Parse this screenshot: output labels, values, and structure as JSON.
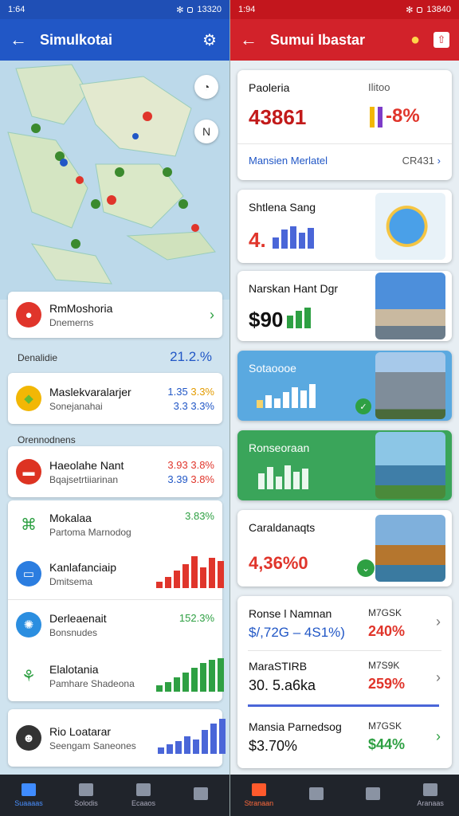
{
  "left": {
    "status": {
      "time": "1:64",
      "right": "13320"
    },
    "title": "Simulkotai",
    "map": {
      "compass_label": "N"
    },
    "featured": {
      "title": "RmMoshoria",
      "subtitle": "Dnemerns"
    },
    "summary": {
      "label": "Denalidie",
      "value": "21.2.%"
    },
    "group1": [
      {
        "title": "Maslekvaralarjer",
        "subtitle": "Sonejanahai",
        "v1": "1.35",
        "v2": "3.3%",
        "v3": "3.3",
        "v4": "3.3%"
      }
    ],
    "section_label": "Orennodnens",
    "group2": [
      {
        "title": "Haeolahe Nant",
        "subtitle": "Bqajsetrtiiarinan",
        "v1": "3.93",
        "v2": "3.8%",
        "v3": "3.39",
        "v4": "3.8%"
      }
    ],
    "group3": [
      {
        "title": "Mokalaa",
        "subtitle": "Partoma Marnodog",
        "value": "3.83%"
      },
      {
        "title": "Kanlafanciaip",
        "subtitle": "Dmitsema",
        "value": ""
      },
      {
        "title": "Derleaenait",
        "subtitle": "Bonsnudes",
        "value": "152.3%"
      },
      {
        "title": "Elalotania",
        "subtitle": "Pamhare Shadeona",
        "value": ""
      }
    ],
    "last": {
      "title": "Rio Loatarar",
      "subtitle": "Seengam Saneones"
    },
    "nav": [
      "Suaaaas",
      "Solodis",
      "Ecaaos",
      ""
    ]
  },
  "right": {
    "status": {
      "time": "1:94",
      "right": "13840"
    },
    "title": "Sumui Ibastar",
    "card1": {
      "title": "Paoleria",
      "value": "43861",
      "meta": "Ilitoo",
      "pct": "-8%",
      "link": "Mansien Merlatel",
      "link_value": "CR431"
    },
    "card2": {
      "title": "Shtlena Sang",
      "value": "4."
    },
    "card3": {
      "title": "Narskan Hant Dgr",
      "value": "$90"
    },
    "card4": {
      "title": "Sotaoooe"
    },
    "card5": {
      "title": "Ronseoraan"
    },
    "card6": {
      "title": "Caraldanaqts",
      "value": "4,36%0"
    },
    "rows": [
      {
        "title": "Ronse l Namnan",
        "value": "$/,72G  – 4S1%)",
        "meta": "M7GSK",
        "pct": "240%"
      },
      {
        "title": "MaraSTIRB",
        "value": "30. 5.a6ka",
        "meta": "M7S9K",
        "pct": "259%"
      },
      {
        "title": "Mansia Parnedsog",
        "value": "$3.70%",
        "meta": "M7GSK",
        "pct": "$44%"
      }
    ],
    "nav": [
      "Stranaan",
      "",
      "",
      "Aranaas"
    ]
  },
  "colors": {
    "left_brand": "#2157c6",
    "right_brand": "#d2222a",
    "up_green": "#2ea043",
    "down_red": "#e0352b",
    "chart_blue": "#4a66d8"
  }
}
